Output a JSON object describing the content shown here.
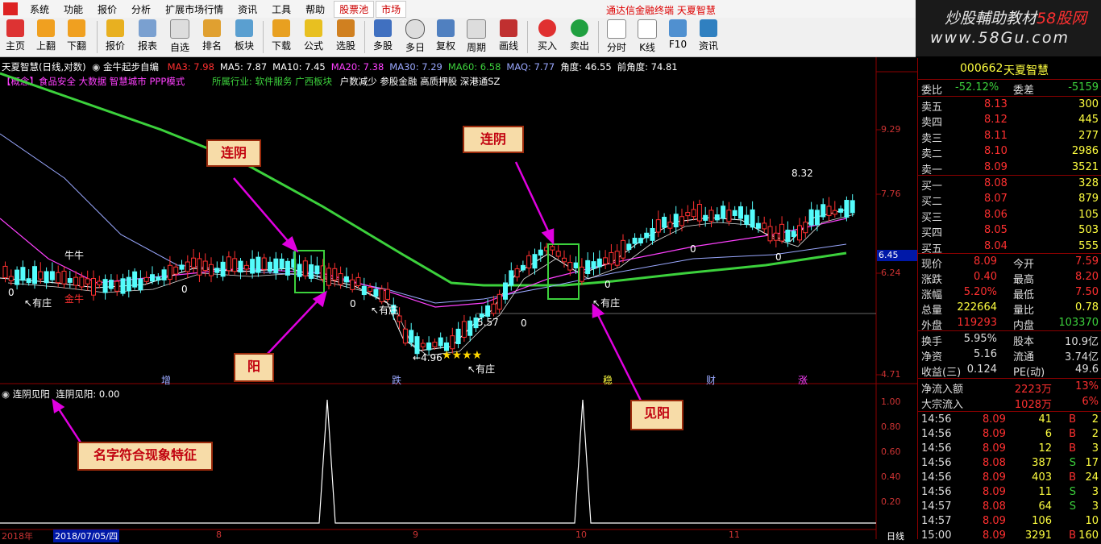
{
  "menu": {
    "items": [
      "系统",
      "功能",
      "报价",
      "分析",
      "扩展市场行情",
      "资讯",
      "工具",
      "帮助"
    ],
    "tabs": [
      "股票池",
      "市场"
    ],
    "brand": "通达信金融终端 天夏智慧"
  },
  "watermark": {
    "line1_text": "炒股輔助教材",
    "line1_site": "58股网",
    "line2": "www.58Gu.com"
  },
  "toolbar": {
    "buttons": [
      "主页",
      "上翻",
      "下翻",
      "报价",
      "报表",
      "自选",
      "排名",
      "板块",
      "下载",
      "公式",
      "选股",
      "多股",
      "多日",
      "复权",
      "周期",
      "画线",
      "买入",
      "卖出",
      "分时",
      "K线",
      "F10",
      "资讯"
    ]
  },
  "chart": {
    "header": {
      "title": "天夏智慧(日线,对数)",
      "indicator": "金牛起步自编",
      "ma_items": [
        {
          "label": "MA3: 7.98",
          "color": "#ff3030"
        },
        {
          "label": "MA5: 7.87",
          "color": "#ffffff"
        },
        {
          "label": "MA10: 7.45",
          "color": "#ffffff"
        },
        {
          "label": "MA20: 7.38",
          "color": "#ff40ff"
        },
        {
          "label": "MA30: 7.29",
          "color": "#9aa8ff"
        },
        {
          "label": "MA60: 6.58",
          "color": "#3cd13c"
        },
        {
          "label": "MAQ: 7.77",
          "color": "#9aa8ff"
        },
        {
          "label": "角度: 46.55",
          "color": "#ffffff"
        },
        {
          "label": "前角度: 74.81",
          "color": "#ffffff"
        }
      ],
      "concepts": "【概念】食品安全 大数据 智慧城市 PPP模式",
      "industry": "所属行业: 软件服务  广西板块",
      "tags": "户数减少 参股金融 高质押股 深港通SZ"
    },
    "price_axis": [
      "9.29",
      "7.76",
      "6.45",
      "6.24",
      "4.71"
    ],
    "price_tag": "6.45",
    "labels": {
      "niuniu": "牛牛",
      "jinniu": "金牛",
      "youzhuang": "有庄",
      "p832": "8.32",
      "p496": "4.96",
      "p557": "5.57",
      "zero": "0"
    },
    "bottom_markers": [
      "增",
      "跌",
      "稳",
      "财",
      "涨"
    ],
    "sub_indicator": {
      "name": "连阴见阳",
      "value_label": "连阴见阳: 0.00"
    },
    "sub_axis": [
      "1.00",
      "0.80",
      "0.60",
      "0.40",
      "0.20"
    ],
    "date_axis": {
      "year": "2018年",
      "selected": "2018/07/05/四",
      "months": [
        "8",
        "9",
        "10",
        "11"
      ],
      "period": "日线"
    }
  },
  "annotations": {
    "lianyin1": "连阴",
    "lianyin2": "连阴",
    "yang": "阳",
    "jianyang": "见阳",
    "name_note": "名字符合现象特征"
  },
  "quote": {
    "code": "000662",
    "name": "天夏智慧",
    "weibi": {
      "label1": "委比",
      "value1": "-52.12%",
      "label2": "委差",
      "value2": "-5159"
    },
    "sells": [
      {
        "label": "卖五",
        "price": "8.13",
        "vol": "300"
      },
      {
        "label": "卖四",
        "price": "8.12",
        "vol": "445"
      },
      {
        "label": "卖三",
        "price": "8.11",
        "vol": "277"
      },
      {
        "label": "卖二",
        "price": "8.10",
        "vol": "2986"
      },
      {
        "label": "卖一",
        "price": "8.09",
        "vol": "3521"
      }
    ],
    "buys": [
      {
        "label": "买一",
        "price": "8.08",
        "vol": "328"
      },
      {
        "label": "买二",
        "price": "8.07",
        "vol": "879"
      },
      {
        "label": "买三",
        "price": "8.06",
        "vol": "105"
      },
      {
        "label": "买四",
        "price": "8.05",
        "vol": "503"
      },
      {
        "label": "买五",
        "price": "8.04",
        "vol": "555"
      }
    ],
    "stats": [
      {
        "l1": "现价",
        "v1": "8.09",
        "c1": "#ff3030",
        "l2": "今开",
        "v2": "7.59",
        "c2": "#ff3030"
      },
      {
        "l1": "涨跌",
        "v1": "0.40",
        "c1": "#ff3030",
        "l2": "最高",
        "v2": "8.20",
        "c2": "#ff3030"
      },
      {
        "l1": "涨幅",
        "v1": "5.20%",
        "c1": "#ff3030",
        "l2": "最低",
        "v2": "7.50",
        "c2": "#ff3030"
      },
      {
        "l1": "总量",
        "v1": "222664",
        "c1": "#ffff40",
        "l2": "量比",
        "v2": "0.78",
        "c2": "#ffff40"
      },
      {
        "l1": "外盘",
        "v1": "119293",
        "c1": "#ff3030",
        "l2": "内盘",
        "v2": "103370",
        "c2": "#3cd13c"
      }
    ],
    "stats2": [
      {
        "l1": "换手",
        "v1": "5.95%",
        "l2": "股本",
        "v2": "10.9亿"
      },
      {
        "l1": "净资",
        "v1": "5.16",
        "l2": "流通",
        "v2": "3.74亿"
      },
      {
        "l1": "收益(三)",
        "v1": "0.124",
        "l2": "PE(动)",
        "v2": "49.6"
      }
    ],
    "flows": [
      {
        "label": "净流入额",
        "value": "2223万",
        "pct": "13%"
      },
      {
        "label": "大宗流入",
        "value": "1028万",
        "pct": "6%"
      }
    ],
    "ticks": [
      {
        "time": "14:56",
        "price": "8.09",
        "vol": "41",
        "side": "B",
        "n": "2"
      },
      {
        "time": "14:56",
        "price": "8.09",
        "vol": "6",
        "side": "B",
        "n": "2"
      },
      {
        "time": "14:56",
        "price": "8.09",
        "vol": "12",
        "side": "B",
        "n": "3"
      },
      {
        "time": "14:56",
        "price": "8.08",
        "vol": "387",
        "side": "S",
        "n": "17"
      },
      {
        "time": "14:56",
        "price": "8.09",
        "vol": "403",
        "side": "B",
        "n": "24"
      },
      {
        "time": "14:56",
        "price": "8.09",
        "vol": "11",
        "side": "S",
        "n": "3"
      },
      {
        "time": "14:57",
        "price": "8.08",
        "vol": "64",
        "side": "S",
        "n": "3"
      },
      {
        "time": "14:57",
        "price": "8.09",
        "vol": "106",
        "side": "",
        "n": "10"
      },
      {
        "time": "15:00",
        "price": "8.09",
        "vol": "3291",
        "side": "B",
        "n": "160"
      }
    ]
  }
}
